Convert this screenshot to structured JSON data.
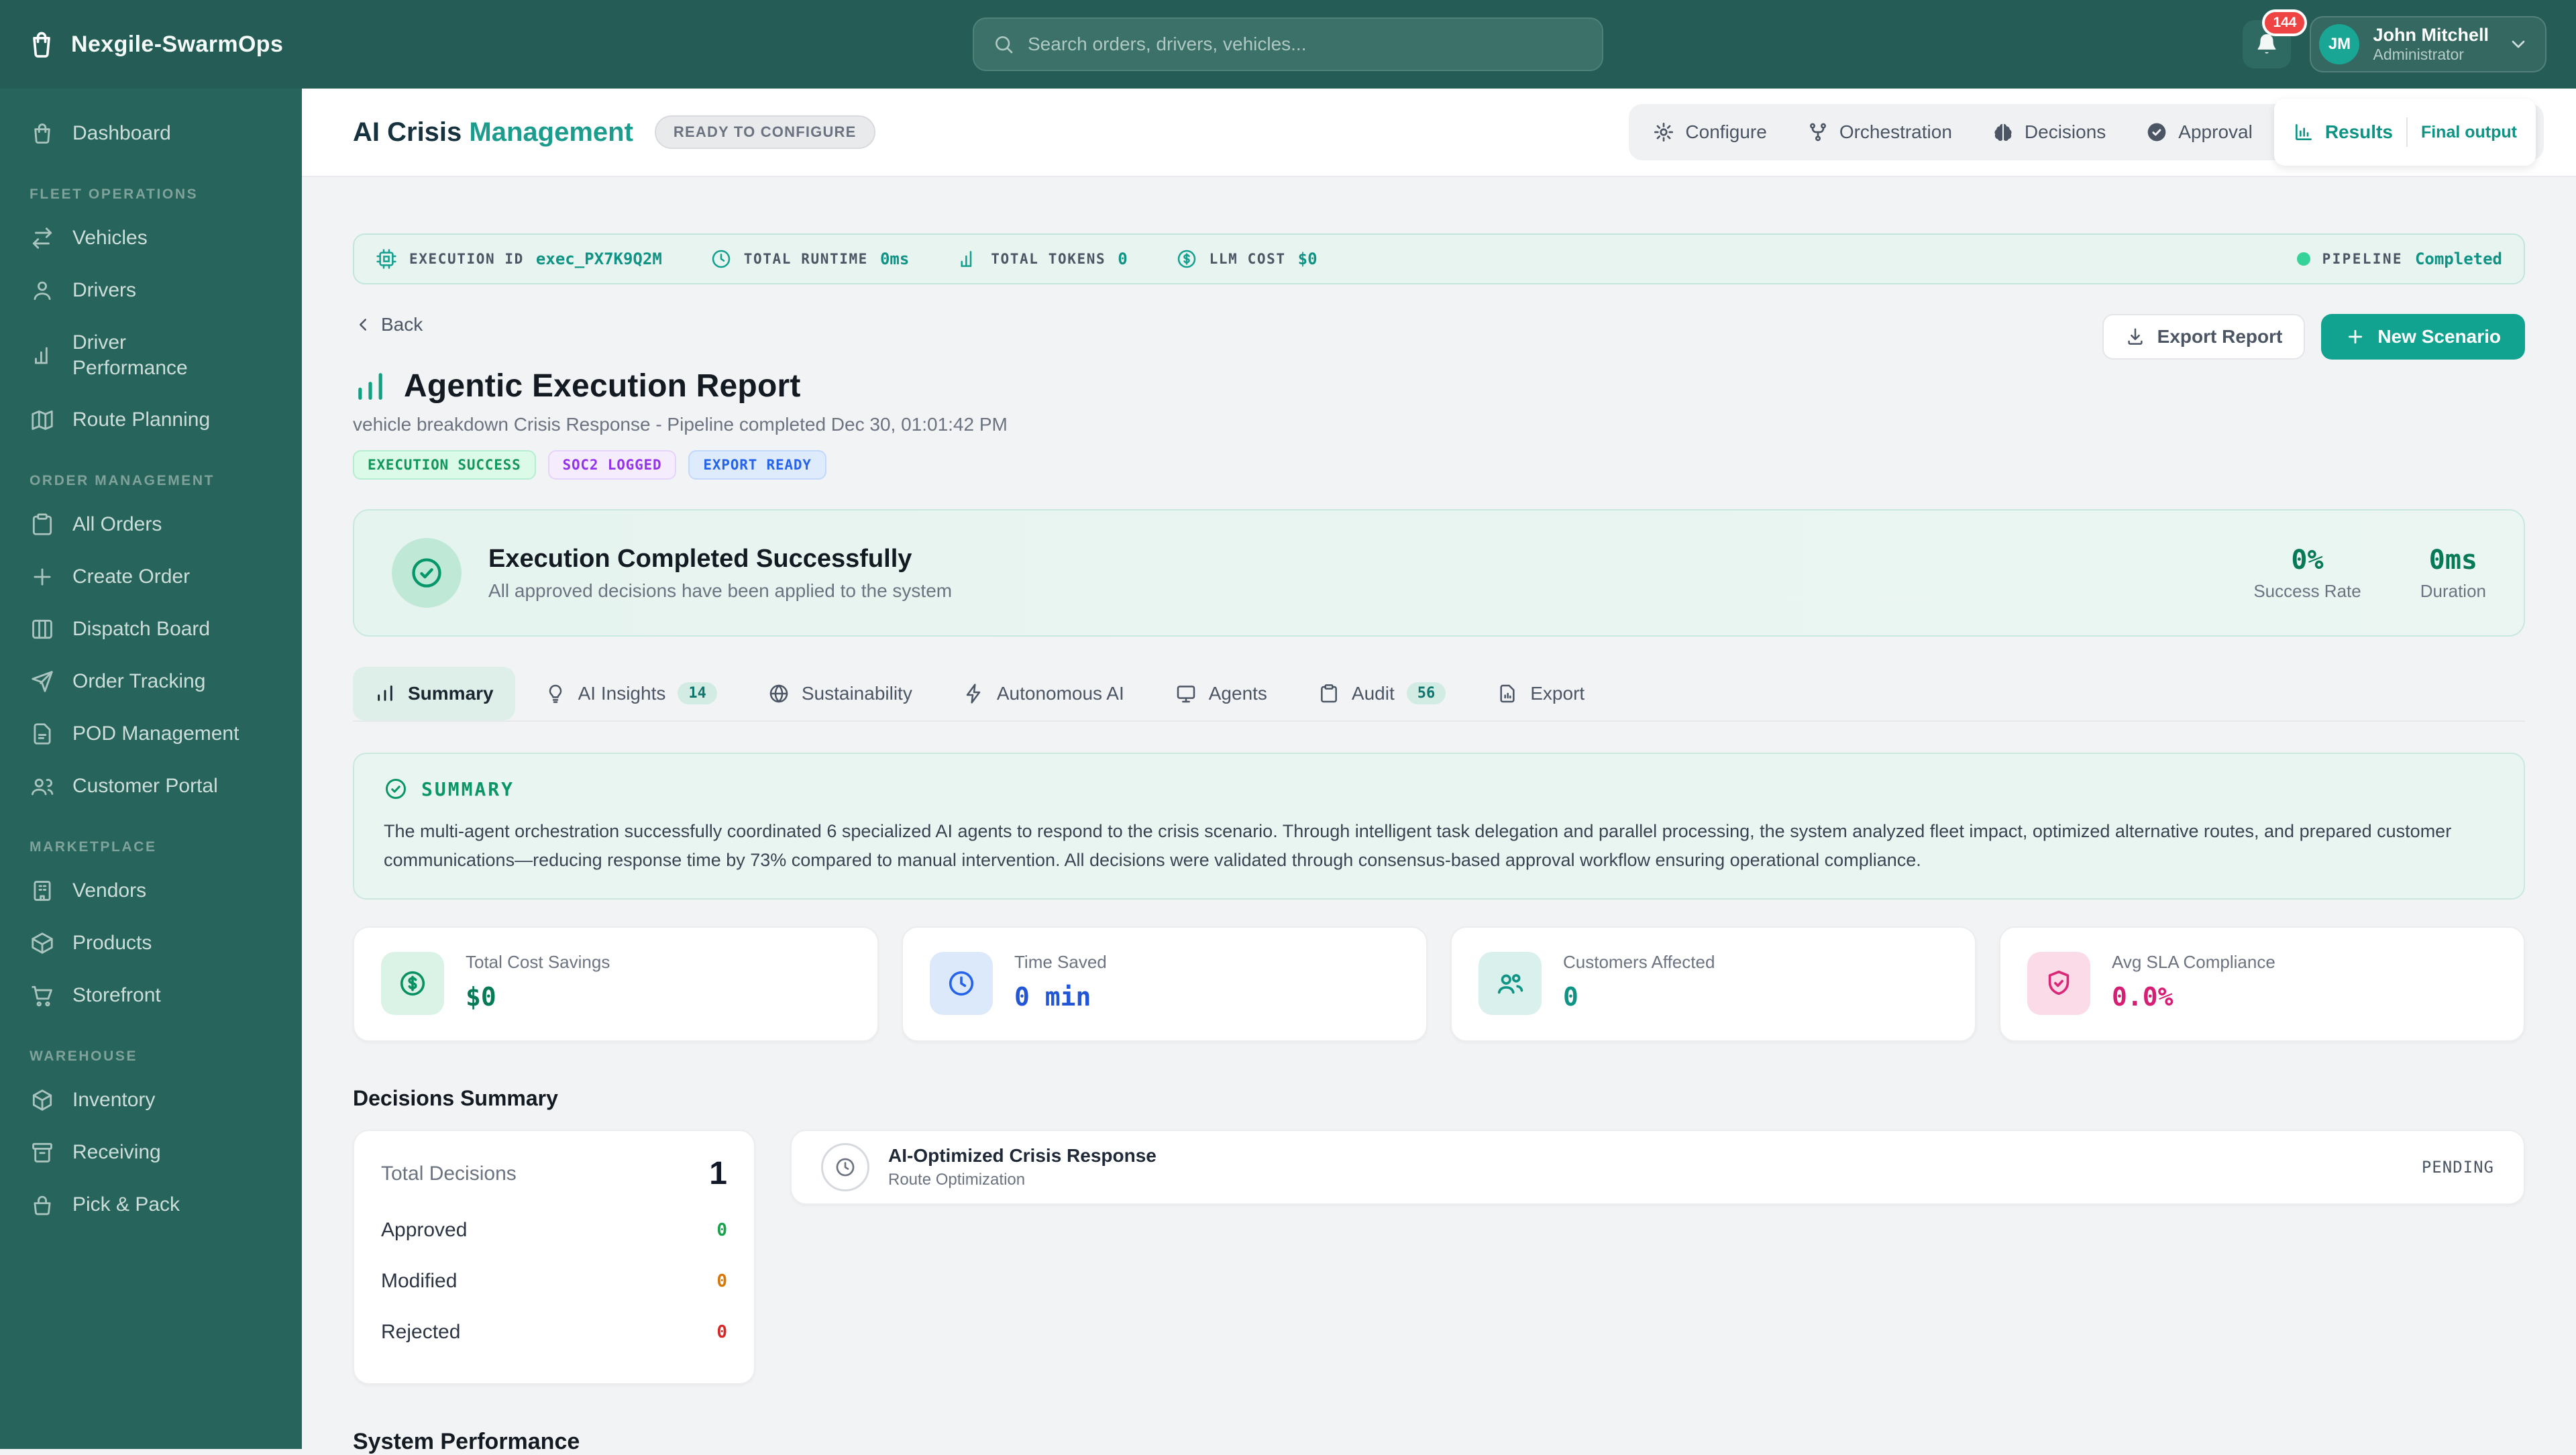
{
  "app": {
    "brand": "Nexgile-SwarmOps"
  },
  "topbar": {
    "search_placeholder": "Search orders, drivers, vehicles...",
    "notification_count": "144",
    "user": {
      "initials": "JM",
      "name": "John Mitchell",
      "role": "Administrator"
    }
  },
  "sidebar": {
    "dashboard": "Dashboard",
    "sections": [
      {
        "title": "FLEET OPERATIONS",
        "items": [
          "Vehicles",
          "Drivers",
          "Driver Performance",
          "Route Planning"
        ]
      },
      {
        "title": "ORDER MANAGEMENT",
        "items": [
          "All Orders",
          "Create Order",
          "Dispatch Board",
          "Order Tracking",
          "POD Management",
          "Customer Portal"
        ]
      },
      {
        "title": "MARKETPLACE",
        "items": [
          "Vendors",
          "Products",
          "Storefront"
        ]
      },
      {
        "title": "WAREHOUSE",
        "items": [
          "Inventory",
          "Receiving",
          "Pick & Pack"
        ]
      }
    ]
  },
  "page_header": {
    "title_primary": "AI Crisis",
    "title_secondary": "Management",
    "status_badge": "READY TO CONFIGURE",
    "steps": [
      "Configure",
      "Orchestration",
      "Decisions",
      "Approval"
    ],
    "active_step": "Results",
    "active_step_sub": "Final output"
  },
  "exec_bar": {
    "items": [
      {
        "label": "EXECUTION ID",
        "value": "exec_PX7K9Q2M"
      },
      {
        "label": "TOTAL RUNTIME",
        "value": "0ms"
      },
      {
        "label": "TOTAL TOKENS",
        "value": "0"
      },
      {
        "label": "LLM COST",
        "value": "$0"
      }
    ],
    "pipeline_label": "PIPELINE",
    "pipeline_status": "Completed"
  },
  "report": {
    "back": "Back",
    "title": "Agentic Execution Report",
    "subtitle": "vehicle breakdown Crisis Response - Pipeline completed Dec 30, 01:01:42 PM",
    "badges": [
      "EXECUTION SUCCESS",
      "SOC2 LOGGED",
      "EXPORT READY"
    ],
    "export_button": "Export Report",
    "new_scenario_button": "New Scenario"
  },
  "banner": {
    "title": "Execution Completed Successfully",
    "subtitle": "All approved decisions have been applied to the system",
    "stats": [
      {
        "value": "0%",
        "label": "Success Rate"
      },
      {
        "value": "0ms",
        "label": "Duration"
      }
    ]
  },
  "tabs": [
    {
      "label": "Summary"
    },
    {
      "label": "AI Insights",
      "badge": "14"
    },
    {
      "label": "Sustainability"
    },
    {
      "label": "Autonomous AI"
    },
    {
      "label": "Agents"
    },
    {
      "label": "Audit",
      "badge": "56"
    },
    {
      "label": "Export"
    }
  ],
  "summary_panel": {
    "heading": "SUMMARY",
    "body": "The multi-agent orchestration successfully coordinated 6 specialized AI agents to respond to the crisis scenario. Through intelligent task delegation and parallel processing, the system analyzed fleet impact, optimized alternative routes, and prepared customer communications—reducing response time by 73% compared to manual intervention. All decisions were validated through consensus-based approval workflow ensuring operational compliance."
  },
  "metrics": [
    {
      "label": "Total Cost Savings",
      "value": "$0"
    },
    {
      "label": "Time Saved",
      "value": "0 min"
    },
    {
      "label": "Customers Affected",
      "value": "0"
    },
    {
      "label": "Avg SLA Compliance",
      "value": "0.0%"
    }
  ],
  "decisions": {
    "heading": "Decisions Summary",
    "total_label": "Total Decisions",
    "total_value": "1",
    "rows": [
      {
        "label": "Approved",
        "value": "0"
      },
      {
        "label": "Modified",
        "value": "0"
      },
      {
        "label": "Rejected",
        "value": "0"
      }
    ],
    "item": {
      "title": "AI-Optimized Crisis Response",
      "subtitle": "Route Optimization",
      "status": "PENDING"
    }
  },
  "next_section": {
    "heading": "System Performance"
  },
  "colors": {
    "topbar": "#255D56",
    "sidebar": "#27645B",
    "accent_teal": "#12A390",
    "success_green": "#059669",
    "badge_red": "#EF4444",
    "warning_orange": "#D97706",
    "danger_red": "#DC2626",
    "info_blue": "#2563EB",
    "pink": "#DB2777",
    "purple": "#9333EA"
  }
}
